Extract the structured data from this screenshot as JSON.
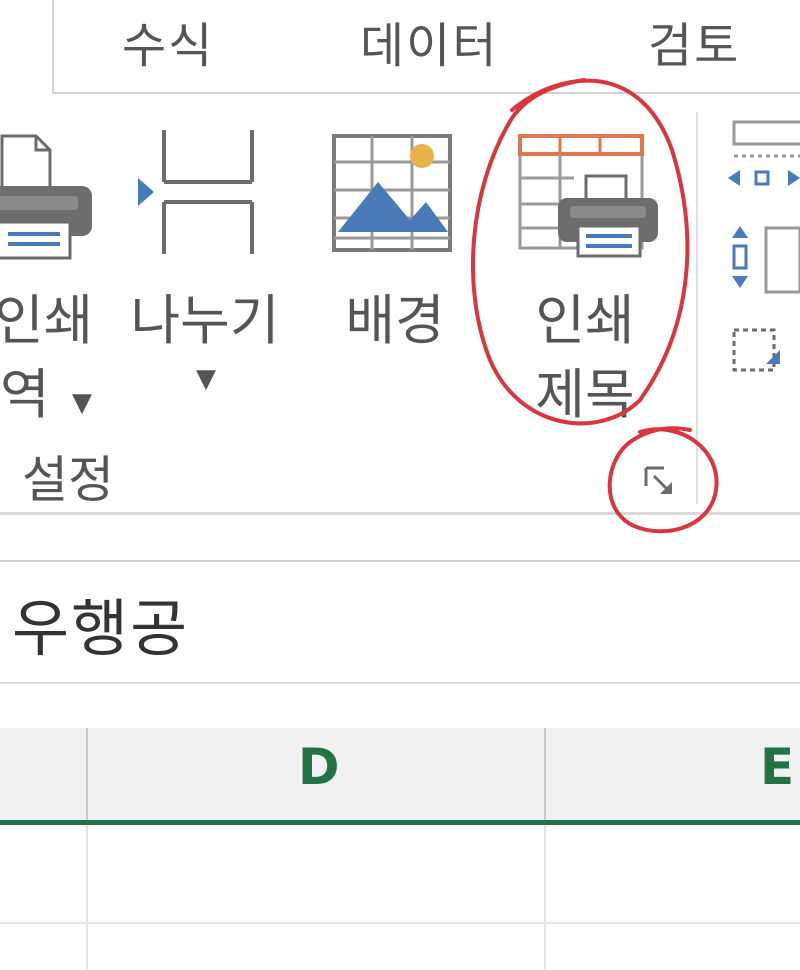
{
  "tabs": [
    {
      "label": "수식"
    },
    {
      "label": "데이터"
    },
    {
      "label": "검토"
    }
  ],
  "ribbon": {
    "print_area": {
      "line1": "인쇄",
      "line2": "역",
      "caret": "▼"
    },
    "breaks": {
      "label": "나누기",
      "caret": "▼"
    },
    "background": {
      "label": "배경"
    },
    "print_titles": {
      "line1": "인쇄",
      "line2": "제목"
    },
    "group_label": "설정"
  },
  "formula_bar": {
    "text": "우행공"
  },
  "grid": {
    "columns": [
      "D",
      "E"
    ]
  },
  "colors": {
    "accent_green": "#217346",
    "annotation_red": "#d9363e",
    "icon_blue": "#4a7ab8",
    "icon_orange": "#e0764f"
  },
  "icons": [
    "printer-icon",
    "page-break-icon",
    "background-image-icon",
    "print-titles-icon",
    "dialog-launcher-icon"
  ]
}
